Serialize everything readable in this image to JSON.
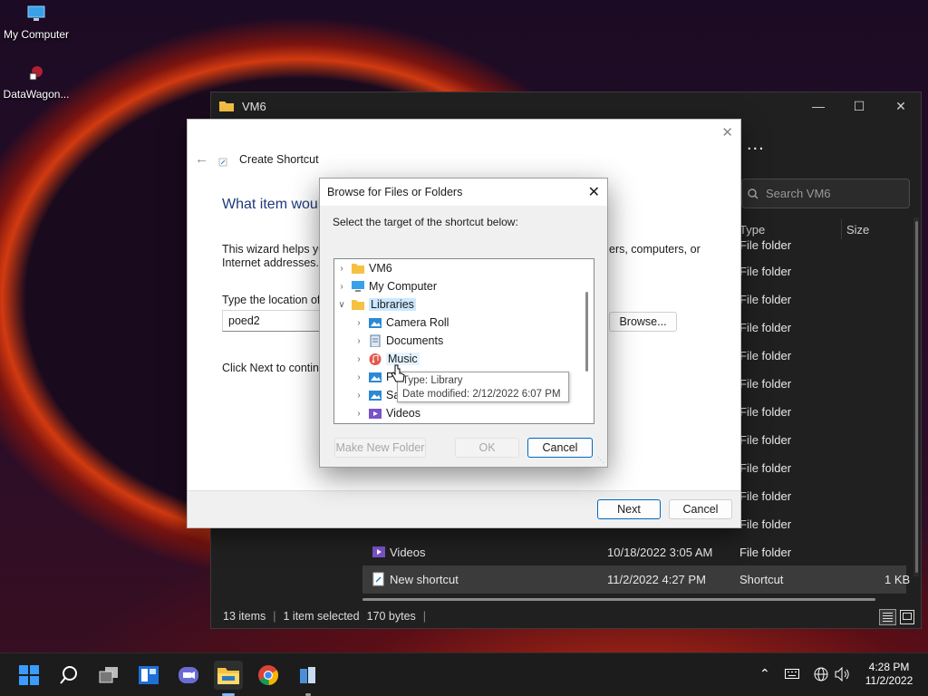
{
  "desktop": {
    "icons": [
      {
        "label": "My Computer",
        "icon": "monitor-icon"
      },
      {
        "label": "DataWagon...",
        "icon": "datawagon-icon"
      }
    ]
  },
  "explorer": {
    "title": "VM6",
    "search_placeholder": "Search VM6",
    "more": "...",
    "columns": {
      "type": "Type",
      "size": "Size"
    },
    "rows": [
      {
        "name": "",
        "date": "",
        "type": "File folder",
        "size": ""
      },
      {
        "name": "",
        "date": "",
        "type": "File folder",
        "size": ""
      },
      {
        "name": "",
        "date": "",
        "type": "File folder",
        "size": ""
      },
      {
        "name": "",
        "date": "",
        "type": "File folder",
        "size": ""
      },
      {
        "name": "",
        "date": "",
        "type": "File folder",
        "size": ""
      },
      {
        "name": "",
        "date": "",
        "type": "File folder",
        "size": ""
      },
      {
        "name": "",
        "date": "",
        "type": "File folder",
        "size": ""
      },
      {
        "name": "",
        "date": "",
        "type": "File folder",
        "size": ""
      },
      {
        "name": "",
        "date": "",
        "type": "File folder",
        "size": ""
      },
      {
        "name": "",
        "date": "",
        "type": "File folder",
        "size": ""
      },
      {
        "name": "",
        "date": "",
        "type": "File folder",
        "size": ""
      },
      {
        "name": "Videos",
        "date": "10/18/2022 3:05 AM",
        "type": "File folder",
        "size": ""
      },
      {
        "name": "New shortcut",
        "date": "11/2/2022 4:27 PM",
        "type": "Shortcut",
        "size": "1 KB"
      }
    ],
    "status": {
      "items": "13 items",
      "selected": "1 item selected",
      "bytes": "170 bytes",
      "sep": "|"
    }
  },
  "wizard": {
    "title": "Create Shortcut",
    "heading": "What item woul",
    "desc_left": "This wizard helps you",
    "desc_left2": "Internet addresses.",
    "desc_right": "ers, computers, or",
    "location_label": "Type the location of t",
    "location_value": "poed2",
    "browse_label": "Browse...",
    "next_hint": "Click Next to continu",
    "next_label": "Next",
    "cancel_label": "Cancel"
  },
  "browse": {
    "title": "Browse for Files or Folders",
    "instruction": "Select the target of the shortcut below:",
    "tree": [
      {
        "label": "VM6",
        "level": 0,
        "expanded": false,
        "icon": "folder-icon"
      },
      {
        "label": "My Computer",
        "level": 0,
        "expanded": false,
        "icon": "monitor-icon"
      },
      {
        "label": "Libraries",
        "level": 0,
        "expanded": true,
        "icon": "folder-icon",
        "highlight": true
      },
      {
        "label": "Camera Roll",
        "level": 1,
        "expanded": false,
        "icon": "picture-library-icon"
      },
      {
        "label": "Documents",
        "level": 1,
        "expanded": false,
        "icon": "documents-library-icon"
      },
      {
        "label": "Music",
        "level": 1,
        "expanded": false,
        "icon": "music-library-icon",
        "hover": true
      },
      {
        "label": "P",
        "level": 1,
        "expanded": false,
        "icon": "picture-library-icon"
      },
      {
        "label": "Sa",
        "level": 1,
        "expanded": false,
        "icon": "picture-library-icon"
      },
      {
        "label": "Videos",
        "level": 1,
        "expanded": false,
        "icon": "video-library-icon"
      }
    ],
    "tooltip": {
      "line1": "Type: Library",
      "line2": "Date modified: 2/12/2022 6:07 PM"
    },
    "new_folder_label": "Make New Folder",
    "ok_label": "OK",
    "cancel_label": "Cancel"
  },
  "taskbar": {
    "apps": [
      "start-icon",
      "search-icon",
      "task-view-icon",
      "widgets-icon",
      "chat-icon",
      "file-explorer-icon",
      "chrome-icon",
      "app-icon"
    ],
    "time": "4:28 PM",
    "date": "11/2/2022"
  }
}
